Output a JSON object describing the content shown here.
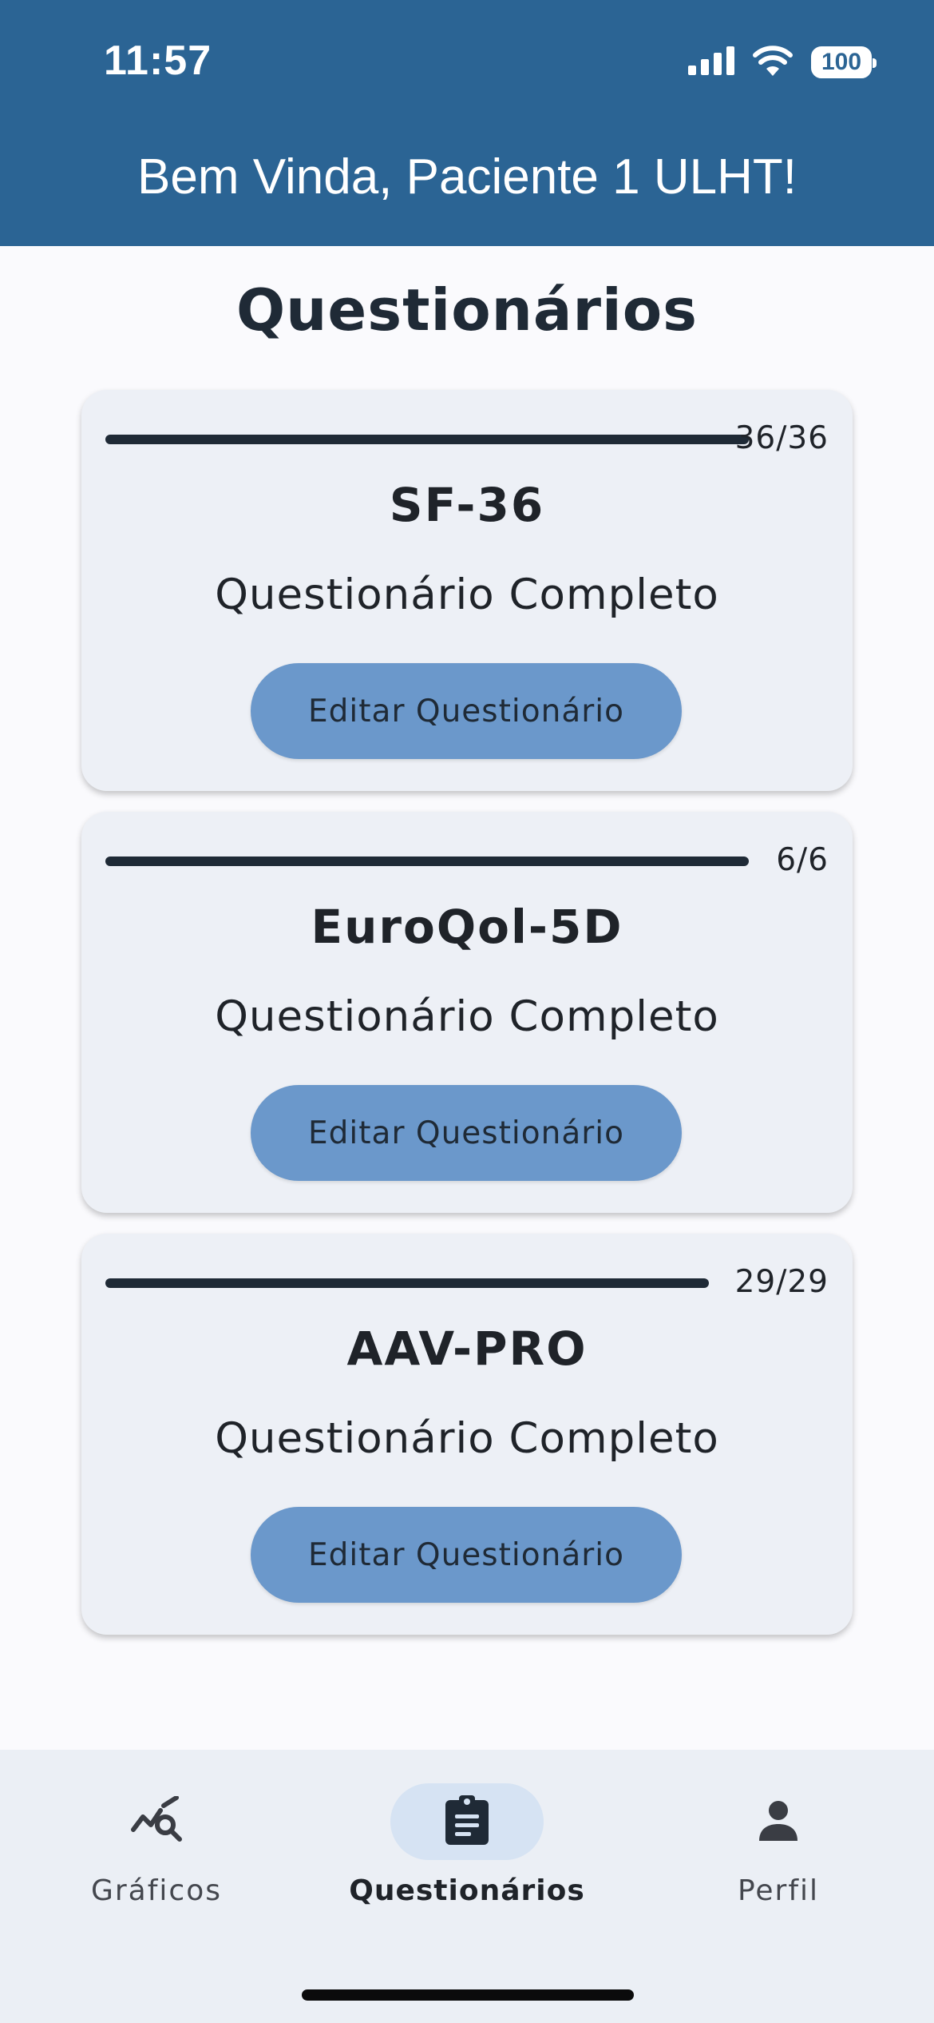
{
  "status_bar": {
    "time": "11:57",
    "battery": "100",
    "icons": [
      "cellular-signal-icon",
      "wifi-icon",
      "battery-icon"
    ]
  },
  "header": {
    "welcome": "Bem Vinda, Paciente 1 ULHT!"
  },
  "page": {
    "title": "Questionários"
  },
  "questionnaires": [
    {
      "title": "SF-36",
      "progress_text": "36/36",
      "progress_fraction": 1.0,
      "status": "Questionário Completo",
      "button_label": "Editar Questionário"
    },
    {
      "title": "EuroQol-5D",
      "progress_text": "6/6",
      "progress_fraction": 1.0,
      "status": "Questionário Completo",
      "button_label": "Editar Questionário"
    },
    {
      "title": "AAV-PRO",
      "progress_text": "29/29",
      "progress_fraction": 1.0,
      "status": "Questionário Completo",
      "button_label": "Editar Questionário"
    }
  ],
  "bottom_nav": {
    "active": "Questionários",
    "items": [
      {
        "label": "Gráficos",
        "icon": "chart-search-icon"
      },
      {
        "label": "Questionários",
        "icon": "clipboard-icon"
      },
      {
        "label": "Perfil",
        "icon": "person-icon"
      }
    ]
  },
  "colors": {
    "header": "#2b6494",
    "card_background": "#edf0f6",
    "button": "#6b98cb",
    "progress": "#1f2a36",
    "nav_background": "#ebeff5",
    "nav_active_indicator": "#d6e3f3"
  }
}
